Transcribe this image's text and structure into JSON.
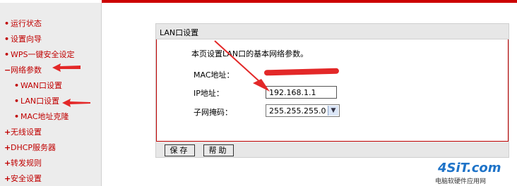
{
  "sidebar": {
    "items": [
      {
        "bullet": "•",
        "label": "运行状态"
      },
      {
        "bullet": "•",
        "label": "设置向导"
      },
      {
        "bullet": "•",
        "label": "WPS一键安全设定"
      },
      {
        "bullet": "−",
        "label": "网络参数"
      },
      {
        "bullet": "•",
        "label": "WAN口设置"
      },
      {
        "bullet": "•",
        "label": "LAN口设置"
      },
      {
        "bullet": "•",
        "label": "MAC地址克隆"
      },
      {
        "bullet": "+",
        "label": "无线设置"
      },
      {
        "bullet": "+",
        "label": "DHCP服务器"
      },
      {
        "bullet": "+",
        "label": "转发规则"
      },
      {
        "bullet": "+",
        "label": "安全设置"
      }
    ]
  },
  "panel": {
    "title": "LAN口设置",
    "description": "本页设置LAN口的基本网络参数。",
    "mac_label": "MAC地址：",
    "ip_label": "IP地址：",
    "ip_value": "192.168.1.1",
    "mask_label": "子网掩码：",
    "mask_value": "255.255.255.0",
    "save_label": "保存",
    "help_label": "帮助"
  },
  "watermark": {
    "logo": "4SiT.com",
    "sub": "电脑软硬件应用网"
  },
  "colors": {
    "nav_text": "#c00000",
    "top_bar": "#cc0000",
    "annotation_arrow": "#e32828"
  }
}
